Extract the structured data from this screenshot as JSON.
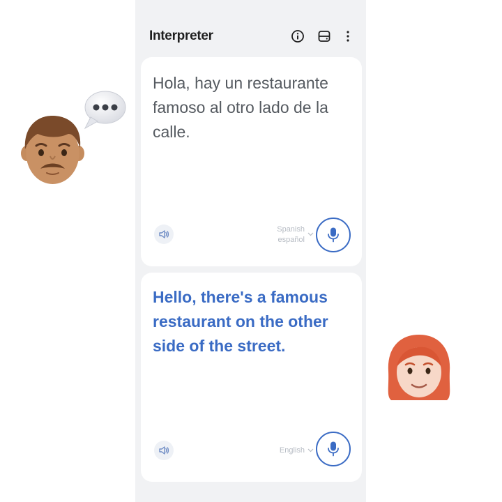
{
  "header": {
    "title": "Interpreter",
    "icons": [
      "info-icon",
      "layout-icon",
      "more-vertical-icon"
    ]
  },
  "source_card": {
    "text": "Hola, hay un restaurante famoso al otro lado de la calle.",
    "language_name": "Spanish",
    "language_native": "español"
  },
  "target_card": {
    "text": "Hello, there's a famous restaurant on the other side of the street.",
    "language_name": "English"
  },
  "overlays": [
    "man-emoji",
    "speech-bubble-emoji",
    "woman-red-hair-emoji"
  ],
  "colors": {
    "accent": "#3a6bc4",
    "source_text": "#555a60",
    "background": "#f1f2f4",
    "card": "#ffffff"
  }
}
